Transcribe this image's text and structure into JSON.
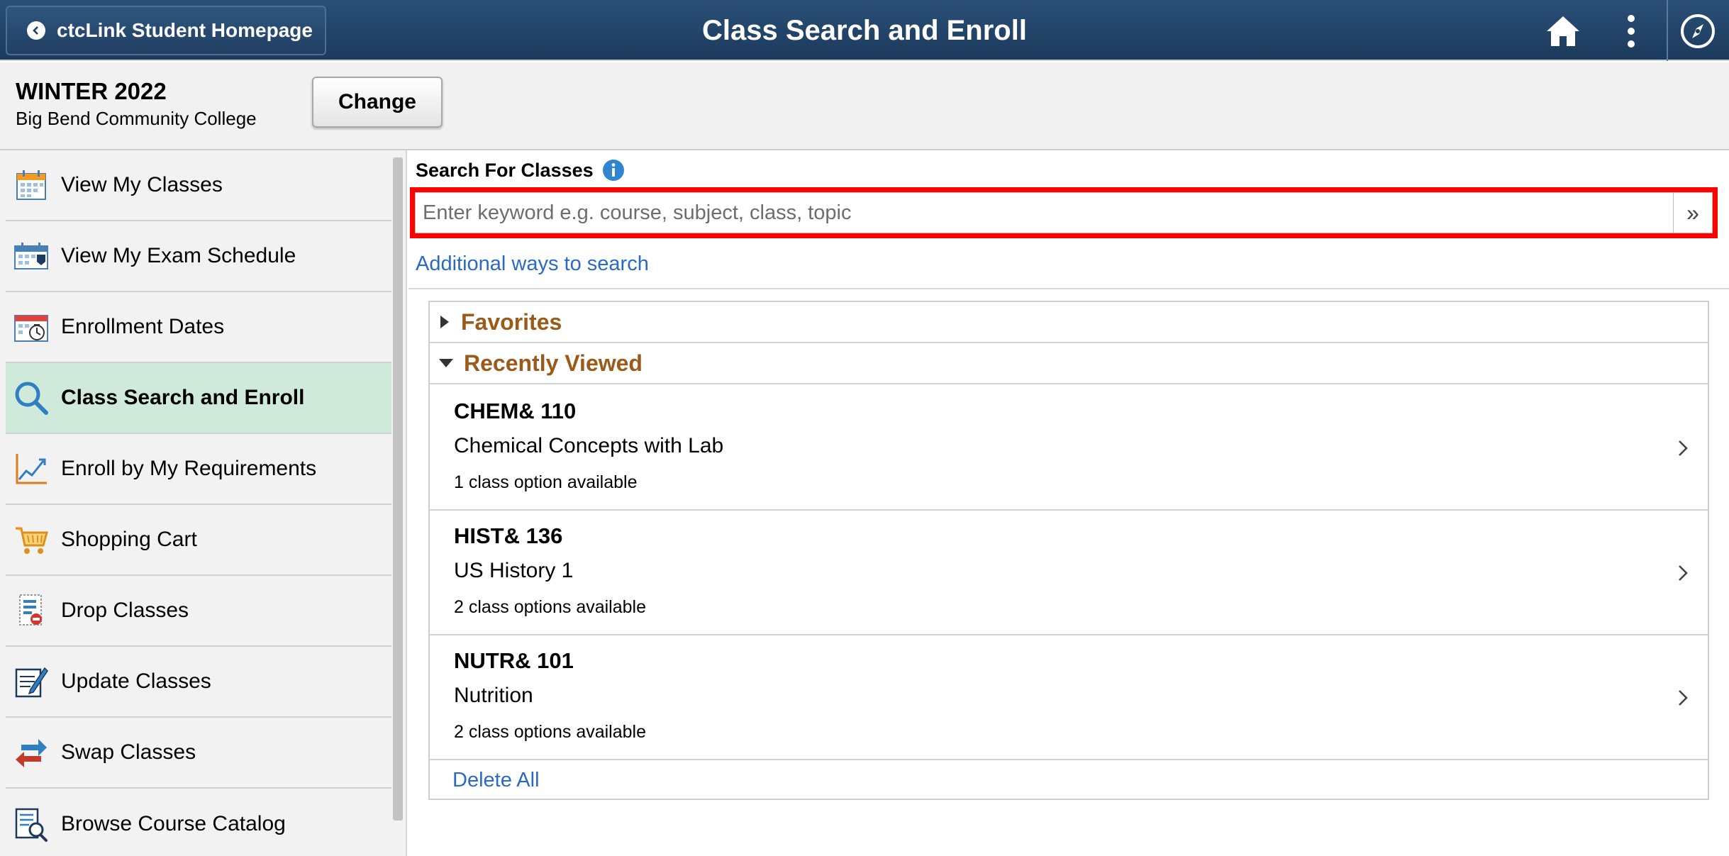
{
  "header": {
    "back_label": "ctcLink Student Homepage",
    "title": "Class Search and Enroll",
    "icons": [
      "home-icon",
      "more-options-icon",
      "navbar-compass-icon"
    ]
  },
  "term": {
    "name": "WINTER 2022",
    "college": "Big Bend Community College",
    "change_label": "Change"
  },
  "sidebar": {
    "items": [
      {
        "label": "View My Classes",
        "icon": "calendar-icon"
      },
      {
        "label": "View My Exam Schedule",
        "icon": "exam-calendar-icon"
      },
      {
        "label": "Enrollment Dates",
        "icon": "calendar-clock-icon"
      },
      {
        "label": "Class Search and Enroll",
        "icon": "search-icon",
        "active": true
      },
      {
        "label": "Enroll by My Requirements",
        "icon": "trend-chart-icon"
      },
      {
        "label": "Shopping Cart",
        "icon": "shopping-cart-icon"
      },
      {
        "label": "Drop Classes",
        "icon": "drop-list-icon"
      },
      {
        "label": "Update Classes",
        "icon": "edit-document-icon"
      },
      {
        "label": "Swap Classes",
        "icon": "swap-arrows-icon"
      },
      {
        "label": "Browse Course Catalog",
        "icon": "catalog-search-icon"
      }
    ]
  },
  "search": {
    "label": "Search For Classes",
    "placeholder": "Enter keyword e.g. course, subject, class, topic",
    "value": "",
    "go_symbol": "»",
    "additional_link": "Additional ways to search"
  },
  "favorites": {
    "title": "Favorites",
    "expanded": false
  },
  "recently_viewed": {
    "title": "Recently Viewed",
    "expanded": true,
    "courses": [
      {
        "code": "CHEM& 110",
        "title": "Chemical Concepts with Lab",
        "options": "1 class option available"
      },
      {
        "code": "HIST& 136",
        "title": "US History 1",
        "options": "2 class options available"
      },
      {
        "code": "NUTR& 101",
        "title": "Nutrition",
        "options": "2 class options available"
      }
    ],
    "delete_all": "Delete All"
  },
  "colors": {
    "header_bg": "#1c3b5c",
    "active_item_bg": "#cfeadb",
    "section_title": "#9a5a1a",
    "link": "#2a6ac4",
    "highlight_border": "#ff0000"
  }
}
